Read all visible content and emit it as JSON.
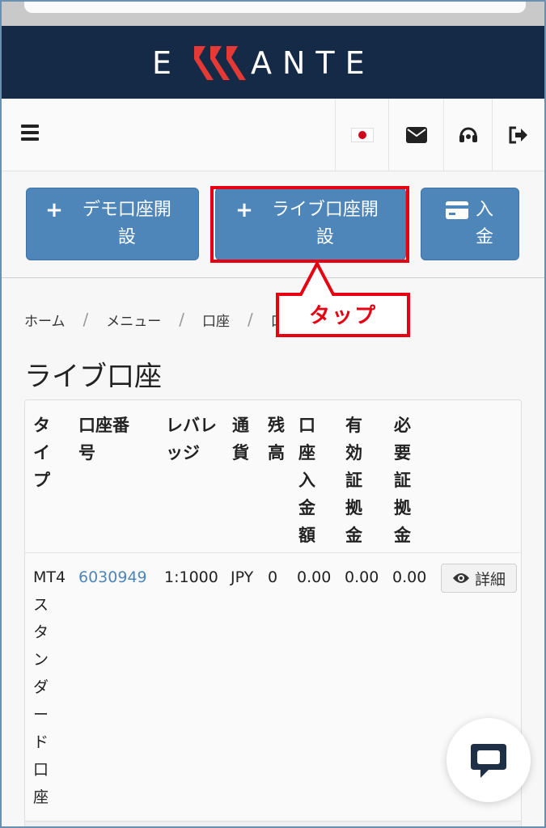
{
  "brand": {
    "name": "ERRANTE",
    "bar_color": "#152a47",
    "accent": "#e53935"
  },
  "toolbar": {
    "menu_icon": "hamburger-icon",
    "flag_icon": "japan-flag-icon",
    "mail_icon": "envelope-icon",
    "support_icon": "headset-icon",
    "logout_icon": "sign-out-icon"
  },
  "actions": {
    "demo_account": "デモ口座開設",
    "live_account": "ライブ口座開設",
    "deposit": "入金",
    "button_color": "#4e86b9"
  },
  "annotation": {
    "callout": "タップ",
    "color": "#e60012"
  },
  "breadcrumb": [
    "ホーム",
    "メニュー",
    "口座",
    "口"
  ],
  "page_title": "ライブ口座",
  "table": {
    "headers": [
      "タイプ",
      "口座番号",
      "レバレッジ",
      "通貨",
      "残高",
      "口座入金額",
      "有効証拠金",
      "必要証拠金"
    ],
    "rows": [
      {
        "type": "MT4スタンダード口座",
        "account_number": "6030949",
        "leverage": "1:1000",
        "currency": "JPY",
        "balance": "0",
        "deposit_amount": "0.00",
        "equity": "0.00",
        "required_margin": "0.00",
        "detail_label": "詳細"
      }
    ]
  },
  "chat_icon": "chat-bubble-icon"
}
